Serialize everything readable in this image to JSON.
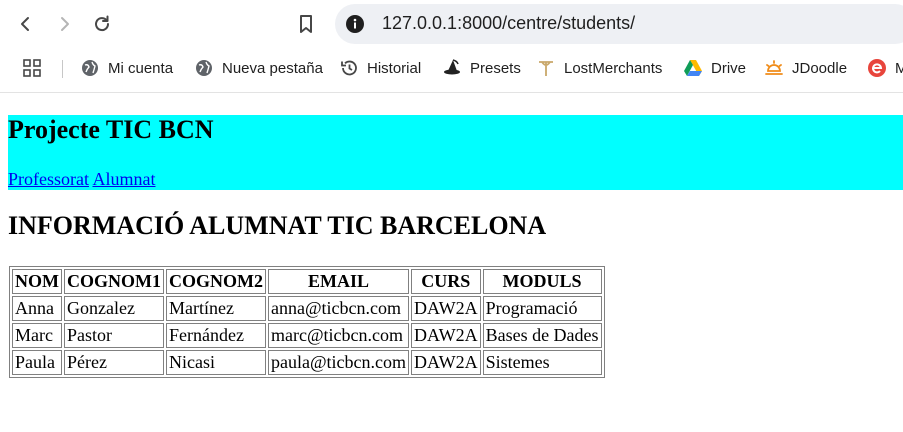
{
  "browser": {
    "url": "127.0.0.1:8000/centre/students/",
    "bookmarks": [
      {
        "label": "Mi cuenta",
        "icon": "globe-icon"
      },
      {
        "label": "Nueva pestaña",
        "icon": "globe-icon"
      },
      {
        "label": "Historial",
        "icon": "history-icon"
      },
      {
        "label": "Presets",
        "icon": "witch-hat-icon"
      },
      {
        "label": "LostMerchants",
        "icon": "lostmerchants-icon"
      },
      {
        "label": "Drive",
        "icon": "drive-icon"
      },
      {
        "label": "JDoodle",
        "icon": "jdoodle-icon"
      },
      {
        "label": "M",
        "icon": "edge-icon"
      }
    ]
  },
  "site": {
    "title": "Projecte TIC BCN",
    "nav": [
      "Professorat",
      "Alumnat"
    ],
    "header_color": "#00ffff"
  },
  "main": {
    "heading": "INFORMACIÓ ALUMNAT TIC BARCELONA",
    "table": {
      "columns": [
        "NOM",
        "COGNOM1",
        "COGNOM2",
        "EMAIL",
        "CURS",
        "MODULS"
      ],
      "rows": [
        [
          "Anna",
          "Gonzalez",
          "Martínez",
          "anna@ticbcn.com",
          "DAW2A",
          "Programació"
        ],
        [
          "Marc",
          "Pastor",
          "Fernández",
          "marc@ticbcn.com",
          "DAW2A",
          "Bases de Dades"
        ],
        [
          "Paula",
          "Pérez",
          "Nicasi",
          "paula@ticbcn.com",
          "DAW2A",
          "Sistemes"
        ]
      ]
    }
  }
}
